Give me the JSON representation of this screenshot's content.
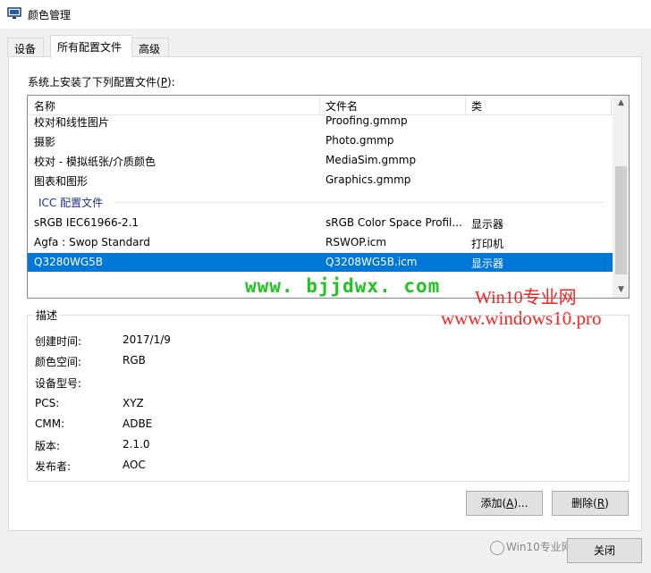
{
  "window": {
    "title": "颜色管理"
  },
  "tabs": [
    {
      "label": "设备"
    },
    {
      "label": "所有配置文件"
    },
    {
      "label": "高级"
    }
  ],
  "installed_label_pre": "系统上安装了下列配置文件(",
  "installed_label_key": "P",
  "installed_label_post": "):",
  "list": {
    "columns": [
      "名称",
      "文件名",
      "类"
    ],
    "rows_top": [
      {
        "name": "校对和线性图片",
        "file": "Proofing.gmmp",
        "type": ""
      },
      {
        "name": "摄影",
        "file": "Photo.gmmp",
        "type": ""
      },
      {
        "name": "校对 - 模拟纸张/介质颜色",
        "file": "MediaSim.gmmp",
        "type": ""
      },
      {
        "name": "图表和图形",
        "file": "Graphics.gmmp",
        "type": ""
      }
    ],
    "group_label": "ICC 配置文件",
    "rows_icc": [
      {
        "name": "sRGB IEC61966-2.1",
        "file": "sRGB Color Space Profil...",
        "type": "显示器"
      },
      {
        "name": "Agfa : Swop Standard",
        "file": "RSWOP.icm",
        "type": "打印机"
      },
      {
        "name": "Q3280WG5B",
        "file": "Q3208WG5B.icm",
        "type": "显示器"
      }
    ]
  },
  "watermarks": {
    "site1": "www. bjjdwx. com",
    "site2_title": "Win10专业网",
    "site2_url": "www.windows10.pro",
    "bottom": "Win10专业网"
  },
  "description": {
    "title": "描述",
    "props": [
      {
        "label": "创建时间:",
        "value": "2017/1/9"
      },
      {
        "label": "颜色空间:",
        "value": "RGB"
      },
      {
        "label": "设备型号:",
        "value": ""
      },
      {
        "label": "PCS:",
        "value": "XYZ"
      },
      {
        "label": "CMM:",
        "value": "ADBE"
      },
      {
        "label": "版本:",
        "value": "2.1.0"
      },
      {
        "label": "发布者:",
        "value": "AOC"
      }
    ]
  },
  "buttons": {
    "add_pre": "添加(",
    "add_key": "A",
    "add_post": ")...",
    "delete_pre": "删除(",
    "delete_key": "R",
    "delete_post": ")",
    "close": "关闭"
  },
  "colors": {
    "selection": "#0078d7",
    "watermark_green": "#1ec51e",
    "watermark_red": "#ff2020"
  }
}
